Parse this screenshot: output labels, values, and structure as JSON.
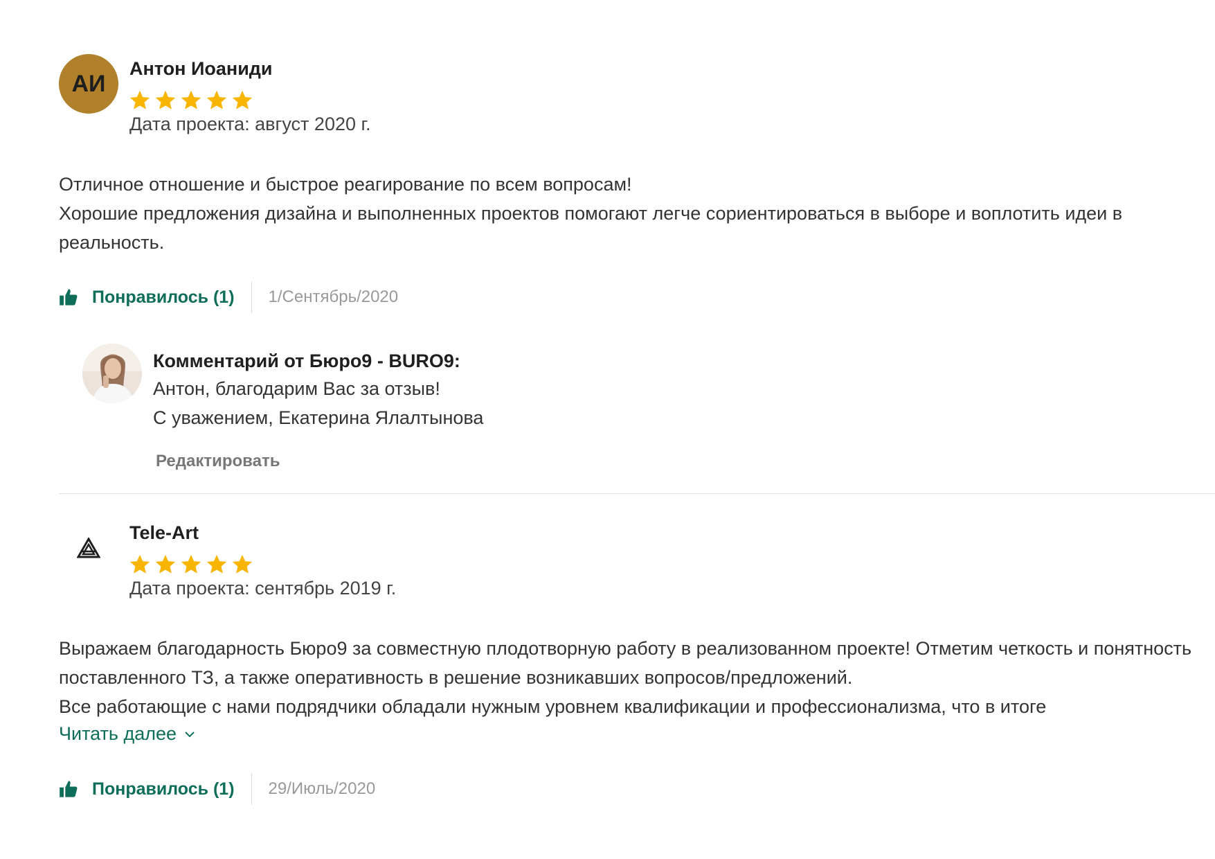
{
  "reviews": [
    {
      "author": "Антон Иоаниди",
      "avatar_initials": "АИ",
      "avatar_color": "#b0802a",
      "rating": 5,
      "project_date": "Дата проекта: август 2020 г.",
      "text_lines": [
        "Отличное отношение и быстрое реагирование по всем вопросам!",
        "Хорошие предложения дизайна и выполненных проектов помогают легче сориентироваться в выборе и воплотить идеи в реальность."
      ],
      "like_label": "Понравилось (1)",
      "date": "1/Сентябрь/2020",
      "reply": {
        "title": "Комментарий от Бюро9 - BURO9:",
        "line1": "Антон, благодарим Вас за отзыв!",
        "line2": "С уважением, Екатерина Ялалтынова",
        "edit_label": "Редактировать"
      }
    },
    {
      "author": "Tele-Art",
      "avatar_icon": "tele-art-logo-icon",
      "rating": 5,
      "project_date": "Дата проекта: сентябрь 2019 г.",
      "text_lines": [
        "Выражаем благодарность Бюро9 за совместную плодотворную работу в реализованном проекте! Отметим четкость и понятность поставленного ТЗ, а также оперативность в решение возникавших вопросов/предложений.",
        "Все работающие с нами подрядчики обладали нужным уровнем квалификации и профессионализма, что в итоге"
      ],
      "read_more_label": "Читать далее",
      "like_label": "Понравилось (1)",
      "date": "29/Июль/2020"
    }
  ],
  "colors": {
    "accent_green": "#0e6e5a",
    "star_yellow": "#f7b500",
    "muted_gray": "#999999"
  }
}
